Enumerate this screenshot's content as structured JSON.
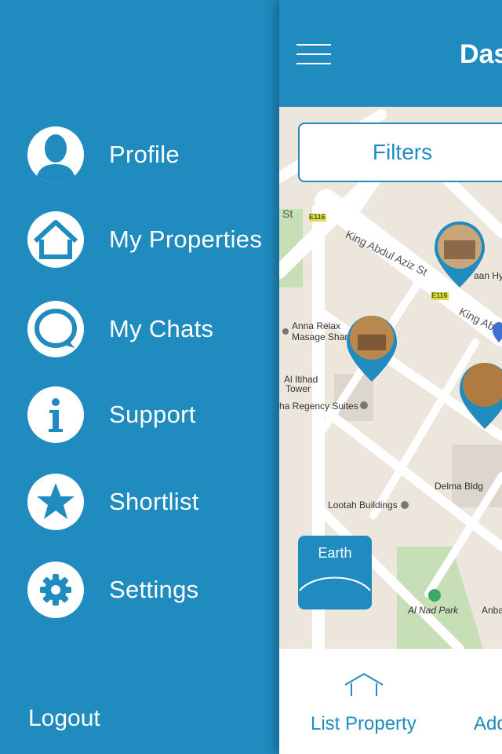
{
  "drawer": {
    "items": [
      {
        "label": "Profile",
        "icon": "profile-icon"
      },
      {
        "label": "My Properties",
        "icon": "home-icon"
      },
      {
        "label": "My Chats",
        "icon": "chat-icon"
      },
      {
        "label": "Support",
        "icon": "info-icon"
      },
      {
        "label": "Shortlist",
        "icon": "star-icon"
      },
      {
        "label": "Settings",
        "icon": "gear-icon"
      }
    ],
    "logout_label": "Logout"
  },
  "header": {
    "title": "Das"
  },
  "map": {
    "filters_label": "Filters",
    "earth_label": "Earth",
    "labels": {
      "street_1": "King Abdul Aziz St",
      "street_2": "King Ab",
      "street_3": "St",
      "place_1": "Anna Relax",
      "place_1b": "Masage Shar",
      "place_2": "Al Itihad",
      "place_2b": "Tower",
      "place_3": "ha Regency Suites",
      "place_4": "Lootah Buildings",
      "place_5": "Delma Bldg",
      "place_6": "Al Nad Park",
      "place_7": "Anba",
      "place_8": "aan Hy",
      "road_1": "E116",
      "road_2": "E116"
    }
  },
  "tabs": {
    "list_property": "List Property",
    "add": "Add"
  },
  "colors": {
    "primary": "#1f8bbf",
    "map_bg": "#ece6dd",
    "white": "#ffffff"
  }
}
